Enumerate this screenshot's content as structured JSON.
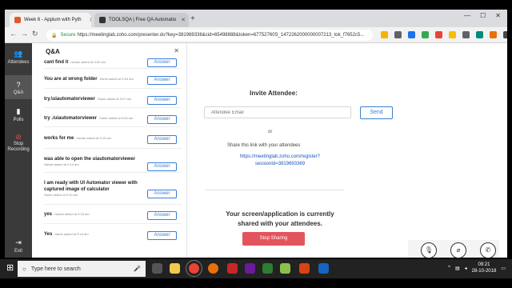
{
  "browser": {
    "tabs": [
      {
        "label": "Week 6 - Appium with Pyth",
        "state": "active"
      },
      {
        "label": "TOOLSQA | Free QA Automatio",
        "state": "inactive"
      }
    ],
    "address": {
      "secure_label": "Secure",
      "url": "https://meetinglab.zoho.com/presenter.do?key=381969336&cid=65498888&token=67752760S_1472262000000007213_tok_f7652c5..."
    }
  },
  "leftnav": {
    "items": [
      {
        "label": "Attendees",
        "icon": "attendees-icon"
      },
      {
        "label": "Q&A",
        "icon": "question-icon"
      },
      {
        "label": "Polls",
        "icon": "polls-icon"
      },
      {
        "label": "Stop Recording",
        "icon": "stop-recording-icon"
      },
      {
        "label": "Exit",
        "icon": "exit-icon"
      }
    ]
  },
  "qa": {
    "title": "Q&A",
    "answer_label": "Answer",
    "items": [
      {
        "question": "cant find it",
        "meta": "Harian asked at 9:20 am"
      },
      {
        "question": "You are at wrong folder",
        "meta": "Samir asked at 9:04 am"
      },
      {
        "question": "try.\\uiautomatorviewer",
        "meta": "Samir asked at 9:07 am"
      },
      {
        "question": "try ./uiautomatorviewer",
        "meta": "Samir asked at 9:08 am"
      },
      {
        "question": "works for me",
        "meta": "Harian asked at 9:13 am"
      },
      {
        "question": "was able to open the uiautomatorviewer",
        "meta": "Harian asked at 9:14 am"
      },
      {
        "question": "I am ready with UI Automator viewer with captured image of calculator",
        "meta": "Samir asked at 9:19 am"
      },
      {
        "question": "yes",
        "meta": "Harian asked at 9:16 am"
      },
      {
        "question": "Yes",
        "meta": "Samir asked at 9:16 am"
      }
    ]
  },
  "main": {
    "invite_title": "Invite Attendee:",
    "email_placeholder": "Attendee Email",
    "send_label": "Send",
    "or_label": "or",
    "share_label": "Share this link with your attendees",
    "share_link_line1": "https://meetinglab.zoho.com/register?",
    "share_link_line2": "sessionId=3819693369",
    "shared_line1": "Your screen/application is currently",
    "shared_line2": "shared with your attendees.",
    "stop_label": "Stop Sharing"
  },
  "controls": {
    "icons": [
      "mic-muted-icon",
      "video-off-icon",
      "phone-icon"
    ]
  },
  "taskbar": {
    "search_placeholder": "Type here to search",
    "time": "09:21",
    "date": "28-10-2018"
  },
  "colors": {
    "accent_blue": "#3b7dd8",
    "stop_red": "#e2555d",
    "sidebar_dark": "#3a3a3a"
  }
}
